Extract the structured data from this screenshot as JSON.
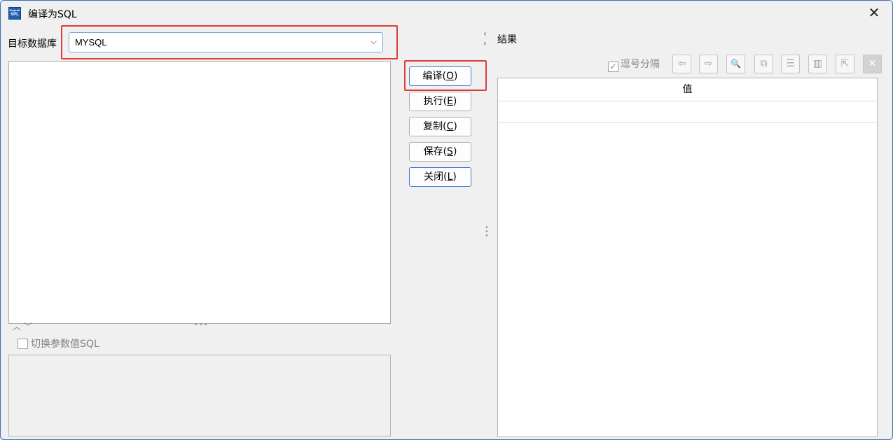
{
  "window": {
    "title": "编译为SQL",
    "app_icon_line1": "Raqsoft",
    "app_icon_line2": "SPL",
    "close_glyph": "✕"
  },
  "left_panel": {
    "target_db_label": "目标数据库",
    "target_db_value": "MYSQL",
    "dropdown_glyph": "⌵",
    "split_arrows": "︿﹀",
    "split_dots": "•••",
    "toggle_param_label": "切换参数值SQL",
    "toggle_param_checked": false
  },
  "buttons": {
    "compile": {
      "text": "编译(",
      "key": "O",
      "end": ")"
    },
    "execute": {
      "text": "执行(",
      "key": "E",
      "end": ")"
    },
    "copy": {
      "text": "复制(",
      "key": "C",
      "end": ")"
    },
    "save": {
      "text": "保存(",
      "key": "S",
      "end": ")"
    },
    "close": {
      "text": "关闭(",
      "key": "L",
      "end": ")"
    }
  },
  "right_panel": {
    "collapse_left": "‹",
    "collapse_right": "›",
    "result_label": "结果",
    "comma_separated_label": "逗号分隔",
    "comma_separated_checked": true,
    "check_glyph": "✓",
    "toolbar_icons": [
      {
        "name": "arrow-left-icon",
        "glyph": "⇦"
      },
      {
        "name": "arrow-right-icon",
        "glyph": "⇨"
      },
      {
        "name": "preview-icon",
        "glyph": "🔍"
      },
      {
        "name": "copy-icon",
        "glyph": "⧉"
      },
      {
        "name": "list-icon",
        "glyph": "☰"
      },
      {
        "name": "chart-icon",
        "glyph": "▥"
      },
      {
        "name": "export-icon",
        "glyph": "⇱"
      },
      {
        "name": "clear-icon",
        "glyph": "✕"
      }
    ],
    "grid_header": "值"
  },
  "colors": {
    "highlight_border": "#e03a3a",
    "focus_border": "#3d7bd2",
    "window_border": "#3c6fb5"
  }
}
